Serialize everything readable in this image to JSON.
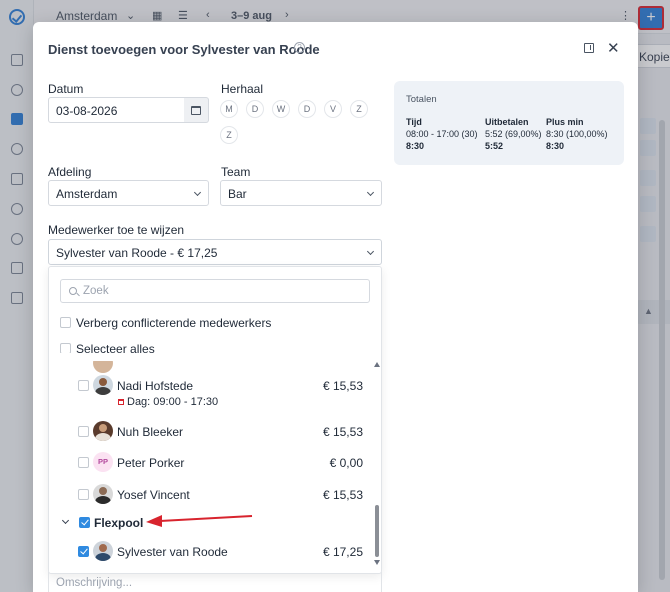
{
  "background": {
    "location": "Amsterdam",
    "week": "3–9 aug",
    "add_label": "+",
    "right_button_label": "Kopieer vanaf"
  },
  "modal": {
    "title": "Dienst toevoegen voor Sylvester van Roode",
    "help_glyph": "?",
    "close_glyph": "✕",
    "date_label": "Datum",
    "date_value": "03-08-2026",
    "repeat_label": "Herhaal",
    "weekdays": [
      "M",
      "D",
      "W",
      "D",
      "V",
      "Z",
      "Z"
    ],
    "department_label": "Afdeling",
    "department_value": "Amsterdam",
    "team_label": "Team",
    "team_value": "Bar",
    "assign_label": "Medewerker toe te wijzen",
    "assign_value": "Sylvester van Roode - € 17,25",
    "description_placeholder": "Omschrijving..."
  },
  "totals": {
    "title": "Totalen",
    "columns": [
      {
        "header": "Tijd",
        "line1": "08:00 - 17:00 (30)",
        "line2": "8:30"
      },
      {
        "header": "Uitbetalen",
        "line1": "5:52 (69,00%)",
        "line2": "5:52"
      },
      {
        "header": "Plus min",
        "line1": "8:30 (100,00%)",
        "line2": "8:30"
      }
    ]
  },
  "dropdown": {
    "search_placeholder": "Zoek",
    "hide_conflicts_label": "Verberg conflicterende medewerkers",
    "select_all_label": "Selecteer alles",
    "employees": [
      {
        "name": "Nadi Hofstede",
        "rate": "€ 15,53",
        "shift": "Dag: 09:00 - 17:30",
        "checked": false,
        "avatar": "photo"
      },
      {
        "name": "Nuh Bleeker",
        "rate": "€ 15,53",
        "checked": false,
        "avatar": "photo"
      },
      {
        "name": "Peter Porker",
        "rate": "€ 0,00",
        "checked": false,
        "avatar": "PP"
      },
      {
        "name": "Yosef Vincent",
        "rate": "€ 15,53",
        "checked": false,
        "avatar": "photo"
      }
    ],
    "group": {
      "name": "Flexpool",
      "checked": true
    },
    "group_members": [
      {
        "name": "Sylvester van Roode",
        "rate": "€ 17,25",
        "checked": true,
        "avatar": "photo"
      }
    ]
  },
  "colors": {
    "accent": "#2f7fd6",
    "annotation_red": "#d8242e",
    "totals_bg": "#eef2f7"
  }
}
